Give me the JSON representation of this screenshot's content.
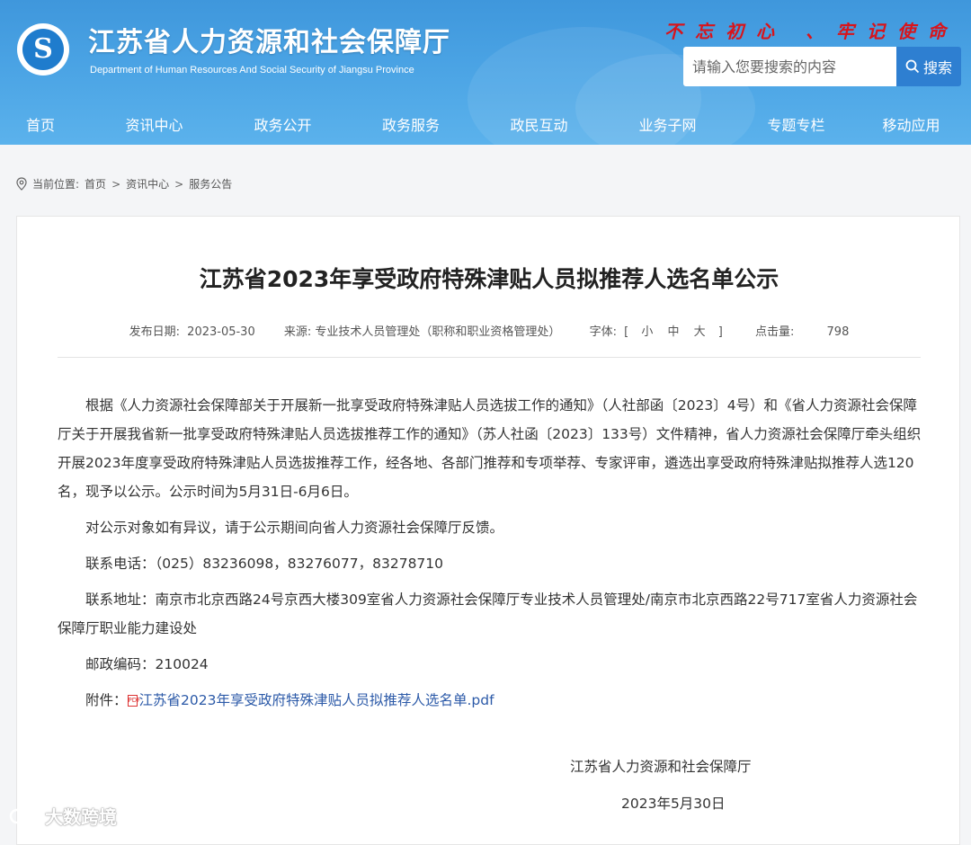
{
  "header": {
    "site_title": "江苏省人力资源和社会保障厅",
    "site_subtitle": "Department of Human Resources And Social Security of Jiangsu Province",
    "slogan": "不忘初心 、牢记使命",
    "search_placeholder": "请输入您要搜索的内容",
    "search_button": "搜索",
    "logo_icon": "jiangsu-hrss-logo"
  },
  "nav": {
    "items": [
      "首页",
      "资讯中心",
      "政务公开",
      "政务服务",
      "政民互动",
      "业务子网",
      "专题专栏",
      "移动应用"
    ]
  },
  "breadcrumb": {
    "label": "当前位置:",
    "items": [
      "首页",
      "资讯中心",
      "服务公告"
    ],
    "separator": ">"
  },
  "article": {
    "title": "江苏省2023年享受政府特殊津贴人员拟推荐人选名单公示",
    "meta": {
      "date_label": "发布日期:",
      "date": "2023-05-30",
      "source_label": "来源:",
      "source": "专业技术人员管理处（职称和职业资格管理处）",
      "font_label": "字体:",
      "font_open": "[",
      "font_small": "小",
      "font_medium": "中",
      "font_large": "大",
      "font_close": "]",
      "clicks_label": "点击量:",
      "clicks": "798"
    },
    "paragraphs": [
      "根据《人力资源社会保障部关于开展新一批享受政府特殊津贴人员选拔工作的通知》（人社部函〔2023〕4号）和《省人力资源社会保障厅关于开展我省新一批享受政府特殊津贴人员选拔推荐工作的通知》（苏人社函〔2023〕133号）文件精神，省人力资源社会保障厅牵头组织开展2023年度享受政府特殊津贴人员选拔推荐工作，经各地、各部门推荐和专项举荐、专家评审，遴选出享受政府特殊津贴拟推荐人选120名，现予以公示。公示时间为5月31日-6月6日。",
      "对公示对象如有异议，请于公示期间向省人力资源社会保障厅反馈。",
      "联系电话：（025）83236098，83276077，83278710",
      "联系地址：南京市北京西路24号京西大楼309室省人力资源社会保障厅专业技术人员管理处/南京市北京西路22号717室省人力资源社会保障厅职业能力建设处",
      "邮政编码：210024"
    ],
    "attachment_label": "附件：",
    "attachment_name": "江苏省2023年享受政府特殊津贴人员拟推荐人选名单.pdf",
    "attachment_icon": "pdf-icon",
    "signature": "江苏省人力资源和社会保障厅",
    "sign_date": "2023年5月30日"
  },
  "watermark": {
    "text": "大数跨境",
    "icon": "brand-logo"
  },
  "colors": {
    "header_blue": "#4aa3e4",
    "search_button": "#2e7fd1",
    "slogan_red": "#d8141b",
    "link_blue": "#2c5aa8"
  }
}
